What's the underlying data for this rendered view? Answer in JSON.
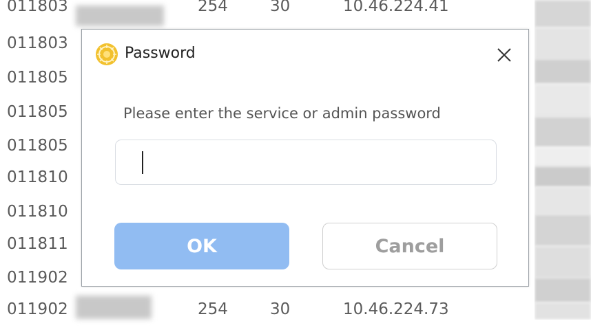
{
  "background_table": {
    "rows": [
      {
        "id": "011803",
        "c2": "254",
        "c3": "30",
        "c4": "10.46.224.41"
      },
      {
        "id": "011803",
        "c2": "",
        "c3": "",
        "c4": ""
      },
      {
        "id": "011805",
        "c2": "",
        "c3": "",
        "c4": ""
      },
      {
        "id": "011805",
        "c2": "",
        "c3": "",
        "c4": ""
      },
      {
        "id": "011805",
        "c2": "",
        "c3": "",
        "c4": ""
      },
      {
        "id": "011810",
        "c2": "",
        "c3": "",
        "c4": ""
      },
      {
        "id": "011810",
        "c2": "",
        "c3": "",
        "c4": ""
      },
      {
        "id": "011811",
        "c2": "",
        "c3": "",
        "c4": ""
      },
      {
        "id": "011902",
        "c2": "",
        "c3": "",
        "c4": ""
      },
      {
        "id": "011902",
        "c2": "254",
        "c3": "30",
        "c4": "10.46.224.73"
      }
    ]
  },
  "dialog": {
    "title": "Password",
    "app_icon": "gold-sun-icon",
    "close_icon": "close-icon",
    "prompt": "Please enter the service or admin password",
    "password_input": {
      "value": "",
      "placeholder": ""
    },
    "ok_label": "OK",
    "cancel_label": "Cancel"
  },
  "colors": {
    "ok_button": "#91bcf2",
    "ok_text": "#ffffff",
    "cancel_text": "#9e9e9e",
    "icon_gold": "#f2c12e"
  }
}
